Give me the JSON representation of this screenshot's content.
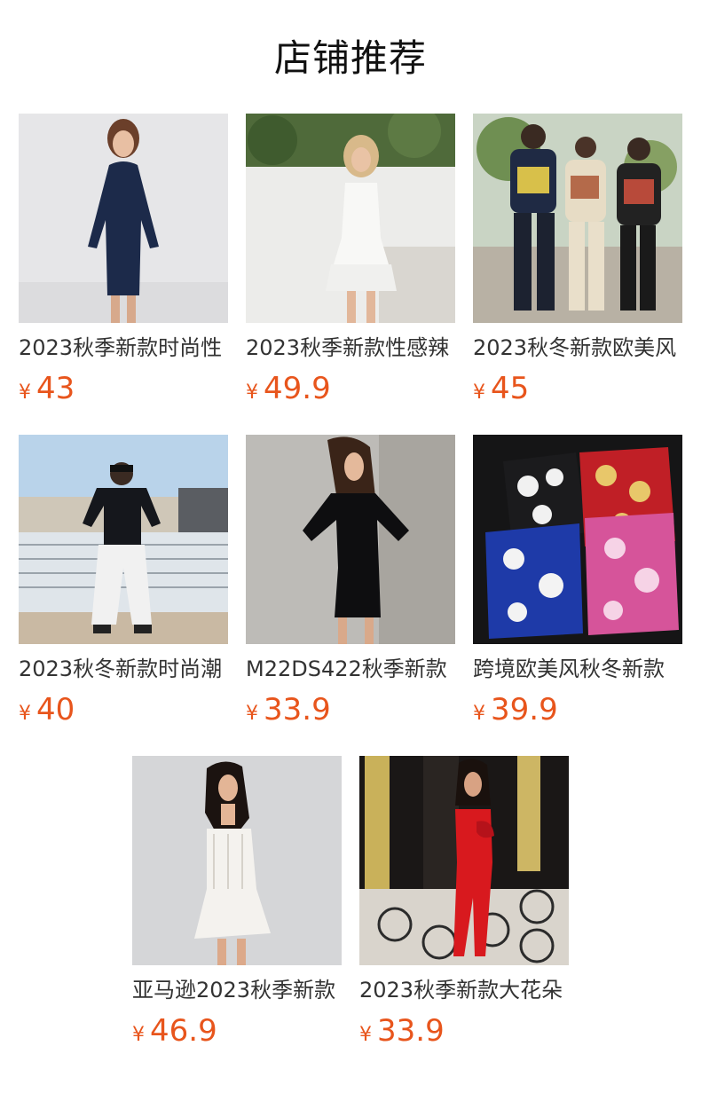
{
  "section": {
    "title": "店铺推荐"
  },
  "accent_color": "#e8551c",
  "currency_symbol": "¥",
  "products": [
    {
      "title": "2023秋季新款时尚性",
      "price": "43",
      "image": "model-navy-bodycon-dress"
    },
    {
      "title": "2023秋季新款性感辣",
      "price": "49.9",
      "image": "model-white-lace-corset-dress"
    },
    {
      "title": "2023秋冬新款欧美风",
      "price": "45",
      "image": "three-men-graphic-hoodies"
    },
    {
      "title": "2023秋冬新款时尚潮",
      "price": "40",
      "image": "man-black-hoodie-white-pants"
    },
    {
      "title": "M22DS422秋季新款",
      "price": "33.9",
      "image": "model-black-mini-dress"
    },
    {
      "title": "跨境欧美风秋冬新款",
      "price": "39.9",
      "image": "floral-print-hoodies-flatlay"
    },
    {
      "title": "亚马逊2023秋季新款",
      "price": "46.9",
      "image": "model-white-lace-strapless-dress"
    },
    {
      "title": "2023秋季新款大花朵",
      "price": "33.9",
      "image": "model-red-strapless-slit-dress"
    }
  ]
}
